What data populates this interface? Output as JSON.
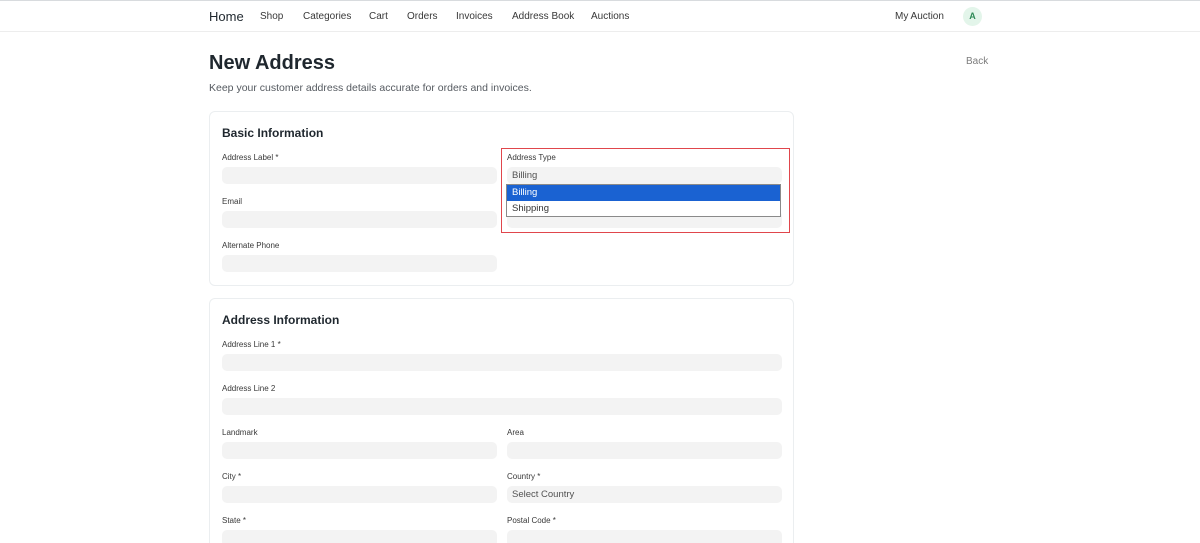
{
  "nav": {
    "brand": "Home",
    "links": [
      "Shop",
      "Categories",
      "Cart",
      "Orders",
      "Invoices",
      "Address Book",
      "Auctions"
    ],
    "my_auction": "My Auction",
    "avatar_initial": "A"
  },
  "page": {
    "title": "New Address",
    "subtitle": "Keep your customer address details accurate for orders and invoices.",
    "back_label": "Back"
  },
  "basic_info": {
    "title": "Basic Information",
    "address_label": "Address Label *",
    "address_type": "Address Type",
    "address_type_value": "Billing",
    "address_type_options": [
      "Billing",
      "Shipping"
    ],
    "email": "Email",
    "alternate_phone": "Alternate Phone"
  },
  "address_info": {
    "title": "Address Information",
    "line1": "Address Line 1 *",
    "line2": "Address Line 2",
    "landmark": "Landmark",
    "area": "Area",
    "city": "City *",
    "country": "Country *",
    "country_placeholder": "Select Country",
    "state": "State *",
    "postal_code": "Postal Code *"
  },
  "colors": {
    "highlight_border": "#e0464c",
    "selected_option": "#1a62d2",
    "avatar_bg": "#e3f5ea",
    "avatar_fg": "#2f8a57"
  }
}
